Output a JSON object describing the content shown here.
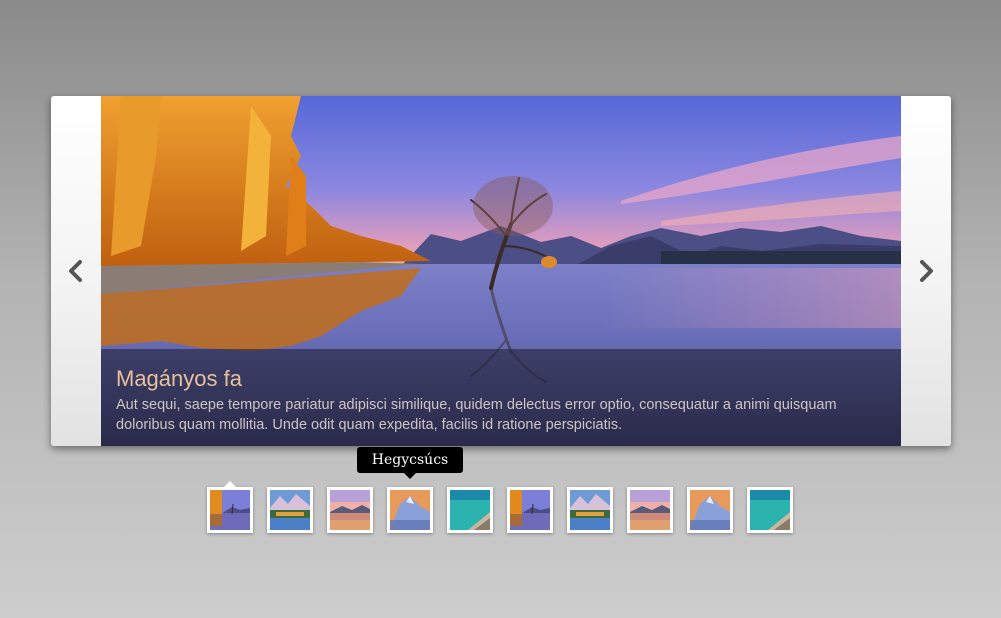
{
  "slider": {
    "prev_icon": "chevron-left-icon",
    "next_icon": "chevron-right-icon",
    "slide": {
      "title": "Magányos fa",
      "text": "Aut sequi, saepe tempore pariatur adipisci similique, quidem delectus error optio, consequatur a animi quisquam doloribus quam mollitia. Unde odit quam expedita, facilis id ratione perspiciatis."
    }
  },
  "tooltip": {
    "text": "Hegycsúcs"
  },
  "thumbnails": {
    "active_index": 0,
    "hover_index": 3,
    "items": [
      {
        "scene": "lonely-tree"
      },
      {
        "scene": "mountain-lake"
      },
      {
        "scene": "sunset-lake"
      },
      {
        "scene": "mountain-peak"
      },
      {
        "scene": "turquoise-coast"
      },
      {
        "scene": "lonely-tree"
      },
      {
        "scene": "mountain-lake"
      },
      {
        "scene": "sunset-lake"
      },
      {
        "scene": "mountain-peak"
      },
      {
        "scene": "turquoise-coast"
      }
    ]
  }
}
